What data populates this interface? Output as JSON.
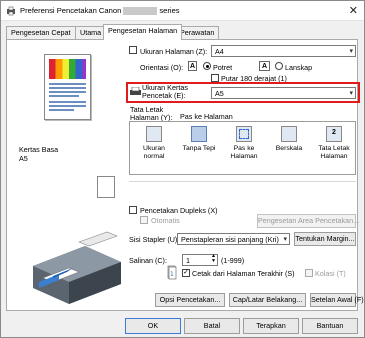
{
  "window": {
    "title_prefix": "Preferensi Pencetakan Canon",
    "title_suffix": "series",
    "close_glyph": "✕"
  },
  "tabs": [
    {
      "label": "Pengesetan Cepat"
    },
    {
      "label": "Utama"
    },
    {
      "label": "Pengesetan Halaman"
    },
    {
      "label": "Perawatan"
    }
  ],
  "active_tab": "Pengesetan Halaman",
  "preview": {
    "paper_label": "Kertas Basa",
    "paper_size": "A5"
  },
  "page_setup": {
    "page_size_label": "Ukuran Halaman (Z):",
    "page_size_value": "A4",
    "orientation_label": "Orientasi (O):",
    "portrait_label": "Potret",
    "landscape_label": "Lanskap",
    "portrait_icon_glyph": "A",
    "landscape_icon_glyph": "A",
    "rotate_label": "Putar 180 derajat (1)",
    "printer_paper_label_line1": "Ukuran Kertas",
    "printer_paper_label_line2": "Pencetak (E):",
    "printer_paper_value": "A5",
    "layout_label_line1": "Tata Letak",
    "layout_label_line2": "Halaman (Y):",
    "layout_current": "Pas ke Halaman",
    "layouts": [
      {
        "label": "Ukuran normal",
        "glyph": ""
      },
      {
        "label": "Tanpa Tepi",
        "glyph": ""
      },
      {
        "label": "Pas ke Halaman",
        "glyph": ""
      },
      {
        "label": "Berskala",
        "glyph": ""
      },
      {
        "label": "Tata Letak Halaman",
        "glyph": "2"
      }
    ],
    "duplex_label": "Pencetakan Dupleks (X)",
    "auto_label": "Otomatis",
    "print_area_button": "Pengesetan Area Pencetakan...",
    "stapler_label": "Sisi Stapler (U):",
    "stapler_value": "Penstapleran sisi panjang (Kri)",
    "margin_button": "Tentukan Margin...",
    "copies_label": "Salinan (C):",
    "copies_value": "1",
    "copies_range": "(1-999)",
    "last_page_label": "Cetak dari Halaman Terakhir (S)",
    "collate_label": "Kolasi (T)",
    "print_options_button": "Opsi Pencetakan...",
    "stamp_button": "Cap/Latar Belakang...",
    "defaults_button": "Setelan Awal (F)"
  },
  "footer": {
    "ok": "OK",
    "cancel": "Batal",
    "apply": "Terapkan",
    "help": "Bantuan"
  },
  "icons": {
    "app": "printer-icon",
    "close": "close-icon",
    "dropdown": "chevron-down-icon"
  },
  "colors": {
    "highlight": "#e01b1b",
    "accent": "#3a7bd5"
  }
}
